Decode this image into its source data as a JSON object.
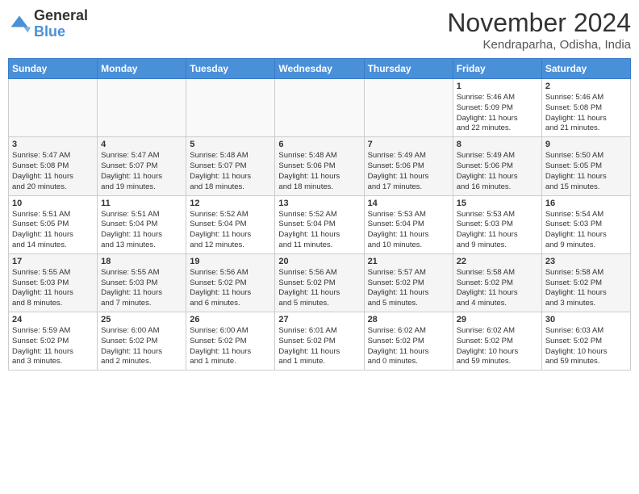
{
  "header": {
    "logo": {
      "line1": "General",
      "line2": "Blue"
    },
    "title": "November 2024",
    "location": "Kendraparha, Odisha, India"
  },
  "weekdays": [
    "Sunday",
    "Monday",
    "Tuesday",
    "Wednesday",
    "Thursday",
    "Friday",
    "Saturday"
  ],
  "weeks": [
    [
      {
        "day": "",
        "info": ""
      },
      {
        "day": "",
        "info": ""
      },
      {
        "day": "",
        "info": ""
      },
      {
        "day": "",
        "info": ""
      },
      {
        "day": "",
        "info": ""
      },
      {
        "day": "1",
        "info": "Sunrise: 5:46 AM\nSunset: 5:09 PM\nDaylight: 11 hours\nand 22 minutes."
      },
      {
        "day": "2",
        "info": "Sunrise: 5:46 AM\nSunset: 5:08 PM\nDaylight: 11 hours\nand 21 minutes."
      }
    ],
    [
      {
        "day": "3",
        "info": "Sunrise: 5:47 AM\nSunset: 5:08 PM\nDaylight: 11 hours\nand 20 minutes."
      },
      {
        "day": "4",
        "info": "Sunrise: 5:47 AM\nSunset: 5:07 PM\nDaylight: 11 hours\nand 19 minutes."
      },
      {
        "day": "5",
        "info": "Sunrise: 5:48 AM\nSunset: 5:07 PM\nDaylight: 11 hours\nand 18 minutes."
      },
      {
        "day": "6",
        "info": "Sunrise: 5:48 AM\nSunset: 5:06 PM\nDaylight: 11 hours\nand 18 minutes."
      },
      {
        "day": "7",
        "info": "Sunrise: 5:49 AM\nSunset: 5:06 PM\nDaylight: 11 hours\nand 17 minutes."
      },
      {
        "day": "8",
        "info": "Sunrise: 5:49 AM\nSunset: 5:06 PM\nDaylight: 11 hours\nand 16 minutes."
      },
      {
        "day": "9",
        "info": "Sunrise: 5:50 AM\nSunset: 5:05 PM\nDaylight: 11 hours\nand 15 minutes."
      }
    ],
    [
      {
        "day": "10",
        "info": "Sunrise: 5:51 AM\nSunset: 5:05 PM\nDaylight: 11 hours\nand 14 minutes."
      },
      {
        "day": "11",
        "info": "Sunrise: 5:51 AM\nSunset: 5:04 PM\nDaylight: 11 hours\nand 13 minutes."
      },
      {
        "day": "12",
        "info": "Sunrise: 5:52 AM\nSunset: 5:04 PM\nDaylight: 11 hours\nand 12 minutes."
      },
      {
        "day": "13",
        "info": "Sunrise: 5:52 AM\nSunset: 5:04 PM\nDaylight: 11 hours\nand 11 minutes."
      },
      {
        "day": "14",
        "info": "Sunrise: 5:53 AM\nSunset: 5:04 PM\nDaylight: 11 hours\nand 10 minutes."
      },
      {
        "day": "15",
        "info": "Sunrise: 5:53 AM\nSunset: 5:03 PM\nDaylight: 11 hours\nand 9 minutes."
      },
      {
        "day": "16",
        "info": "Sunrise: 5:54 AM\nSunset: 5:03 PM\nDaylight: 11 hours\nand 9 minutes."
      }
    ],
    [
      {
        "day": "17",
        "info": "Sunrise: 5:55 AM\nSunset: 5:03 PM\nDaylight: 11 hours\nand 8 minutes."
      },
      {
        "day": "18",
        "info": "Sunrise: 5:55 AM\nSunset: 5:03 PM\nDaylight: 11 hours\nand 7 minutes."
      },
      {
        "day": "19",
        "info": "Sunrise: 5:56 AM\nSunset: 5:02 PM\nDaylight: 11 hours\nand 6 minutes."
      },
      {
        "day": "20",
        "info": "Sunrise: 5:56 AM\nSunset: 5:02 PM\nDaylight: 11 hours\nand 5 minutes."
      },
      {
        "day": "21",
        "info": "Sunrise: 5:57 AM\nSunset: 5:02 PM\nDaylight: 11 hours\nand 5 minutes."
      },
      {
        "day": "22",
        "info": "Sunrise: 5:58 AM\nSunset: 5:02 PM\nDaylight: 11 hours\nand 4 minutes."
      },
      {
        "day": "23",
        "info": "Sunrise: 5:58 AM\nSunset: 5:02 PM\nDaylight: 11 hours\nand 3 minutes."
      }
    ],
    [
      {
        "day": "24",
        "info": "Sunrise: 5:59 AM\nSunset: 5:02 PM\nDaylight: 11 hours\nand 3 minutes."
      },
      {
        "day": "25",
        "info": "Sunrise: 6:00 AM\nSunset: 5:02 PM\nDaylight: 11 hours\nand 2 minutes."
      },
      {
        "day": "26",
        "info": "Sunrise: 6:00 AM\nSunset: 5:02 PM\nDaylight: 11 hours\nand 1 minute."
      },
      {
        "day": "27",
        "info": "Sunrise: 6:01 AM\nSunset: 5:02 PM\nDaylight: 11 hours\nand 1 minute."
      },
      {
        "day": "28",
        "info": "Sunrise: 6:02 AM\nSunset: 5:02 PM\nDaylight: 11 hours\nand 0 minutes."
      },
      {
        "day": "29",
        "info": "Sunrise: 6:02 AM\nSunset: 5:02 PM\nDaylight: 10 hours\nand 59 minutes."
      },
      {
        "day": "30",
        "info": "Sunrise: 6:03 AM\nSunset: 5:02 PM\nDaylight: 10 hours\nand 59 minutes."
      }
    ]
  ]
}
